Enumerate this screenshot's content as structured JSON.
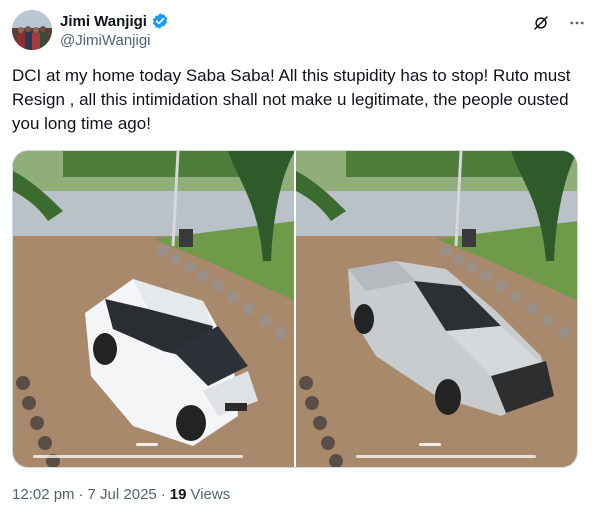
{
  "author": {
    "display_name": "Jimi Wanjigi",
    "handle": "@JimiWanjigi",
    "verified": true
  },
  "tweet": {
    "text": "DCI at my home today Saba Saba! All this stupidity has to stop! Ruto must Resign , all this intimidation shall not make u legitimate, the people ousted you long time ago!"
  },
  "media": {
    "photos": [
      {
        "description_icon": "white-suv-photo"
      },
      {
        "description_icon": "silver-pickup-photo"
      }
    ]
  },
  "meta": {
    "time": "12:02 pm",
    "separator": "·",
    "date": "7 Jul 2025",
    "views_count": "19",
    "views_label": "Views"
  },
  "icons": {
    "verified": "verified-badge-icon",
    "grok": "grok-icon",
    "more": "more-icon"
  },
  "colors": {
    "verified_blue": "#1d9bf0",
    "secondary_text": "#536471",
    "primary_text": "#0f1419"
  }
}
